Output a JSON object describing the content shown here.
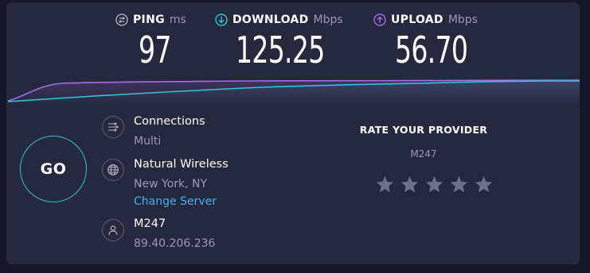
{
  "metrics": {
    "ping": {
      "label": "PING",
      "unit": "ms",
      "value": "97",
      "icon": "ping-icon"
    },
    "download": {
      "label": "DOWNLOAD",
      "unit": "Mbps",
      "value": "125.25",
      "icon": "download-icon"
    },
    "upload": {
      "label": "UPLOAD",
      "unit": "Mbps",
      "value": "56.70",
      "icon": "upload-icon"
    }
  },
  "colors": {
    "download": "#2fc6d3",
    "upload": "#a66cf0",
    "card": "#26283e",
    "link": "#3fb1f2"
  },
  "go_button": {
    "label": "GO"
  },
  "connections": {
    "title": "Connections",
    "value": "Multi",
    "icon": "connections-icon"
  },
  "server": {
    "name": "Natural Wireless",
    "location": "New York, NY",
    "change_label": "Change Server",
    "icon": "globe-icon"
  },
  "isp": {
    "name": "M247",
    "ip": "89.40.206.236",
    "icon": "user-icon"
  },
  "rating": {
    "title": "RATE YOUR PROVIDER",
    "provider": "M247",
    "stars_total": 5
  }
}
